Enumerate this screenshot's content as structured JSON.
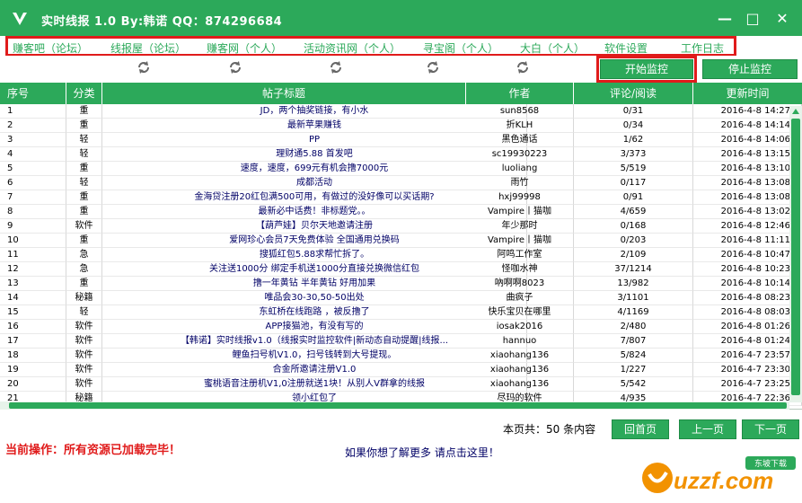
{
  "app": {
    "title": "实时线报 1.0  By:韩诺 QQ：874296684",
    "accent": "#2ca95a"
  },
  "window_controls": {
    "minimize": "—",
    "maximize": "□",
    "close": "✕"
  },
  "menu": {
    "items": [
      "赚客吧（论坛）",
      "线报屋（论坛）",
      "赚客网（个人）",
      "活动资讯网（个人）",
      "寻宝阁（个人）",
      "大白（个人）",
      "软件设置",
      "工作日志"
    ]
  },
  "toolbar": {
    "start_label": "开始监控",
    "stop_label": "停止监控",
    "refresh_icons": [
      "refresh-icon",
      "refresh-icon",
      "refresh-icon",
      "refresh-icon",
      "refresh-icon"
    ]
  },
  "table": {
    "headers": [
      "序号",
      "分类",
      "帖子标题",
      "作者",
      "评论/阅读",
      "更新时间"
    ],
    "rows": [
      [
        "1",
        "重",
        "JD，两个抽奖链接，有小水",
        "sun8568",
        "0/31",
        "2016-4-8 14:27"
      ],
      [
        "2",
        "重",
        "最新苹果赚钱",
        "折KLH",
        "0/34",
        "2016-4-8 14:14"
      ],
      [
        "3",
        "轻",
        "PP",
        "黑色通话",
        "1/62",
        "2016-4-8 14:06"
      ],
      [
        "4",
        "轻",
        "理财通5.88 首发吧",
        "sc19930223",
        "3/373",
        "2016-4-8 13:15"
      ],
      [
        "5",
        "重",
        "速度，速度，699元有机会撸7000元",
        "luoliang",
        "5/519",
        "2016-4-8 13:10"
      ],
      [
        "6",
        "轻",
        "成都活动",
        "雨竹",
        "0/117",
        "2016-4-8 13:08"
      ],
      [
        "7",
        "重",
        "金海贷注册20红包满500可用，有做过的没好像可以买话期?",
        "hxj99998",
        "0/91",
        "2016-4-8 13:08"
      ],
      [
        "8",
        "重",
        "最新必中话费！非标题党。。",
        "Vampire丨猫咖",
        "4/659",
        "2016-4-8 13:02"
      ],
      [
        "9",
        "软件",
        "【葫芦娃】贝尔天地邀请注册",
        "年少那时",
        "0/168",
        "2016-4-8 12:46"
      ],
      [
        "10",
        "重",
        "爱网珍心会员7天免费体验 全国通用兑换码",
        "Vampire丨猫咖",
        "0/203",
        "2016-4-8 11:11"
      ],
      [
        "11",
        "急",
        "搜狐红包5.88求帮忙拆了。",
        "阿鸣工作室",
        "2/109",
        "2016-4-8 10:47"
      ],
      [
        "12",
        "急",
        "关注送1000分 绑定手机送1000分直接兑换微信红包",
        "怪咖水神",
        "37/1214",
        "2016-4-8 10:23"
      ],
      [
        "13",
        "重",
        "撸一年黄钻    半年黄钻    好用加果",
        "吶啊啊8023",
        "13/982",
        "2016-4-8 10:14"
      ],
      [
        "14",
        "秘籍",
        "唯品会30-30,50-50出处",
        "曲疯子",
        "3/1101",
        "2016-4-8 08:23"
      ],
      [
        "15",
        "轻",
        "东虹桥在线跑路 ，被反撸了",
        "快乐宝贝在哪里",
        "4/1169",
        "2016-4-8 08:03"
      ],
      [
        "16",
        "软件",
        "APP接猫池，有没有写的",
        "iosak2016",
        "2/480",
        "2016-4-8 01:26"
      ],
      [
        "17",
        "软件",
        "【韩诺】实时线报v1.0（线报实时监控软件|新动态自动提醒|线报...",
        "hannuo",
        "7/807",
        "2016-4-8 01:24"
      ],
      [
        "18",
        "软件",
        "鲤鱼扫号机V1.0，扫号钱转到大号提现。",
        "xiaohang136",
        "5/824",
        "2016-4-7 23:57"
      ],
      [
        "19",
        "软件",
        "合金所邀请注册V1.0",
        "xiaohang136",
        "1/227",
        "2016-4-7 23:30"
      ],
      [
        "20",
        "软件",
        "蜜桃语音注册机V1,0注册就送1块！从别人V群拿的线报",
        "xiaohang136",
        "5/542",
        "2016-4-7 23:25"
      ],
      [
        "21",
        "秘籍",
        "领小红包了",
        "尽玛的软件",
        "4/935",
        "2016-4-7 22:36"
      ]
    ]
  },
  "footer": {
    "page_info": "本页共：50 条内容",
    "btn_home": "回首页",
    "btn_prev": "上一页",
    "btn_next": "下一页",
    "status": "当前操作：所有资源已加载完毕！",
    "learn_more": "如果你想了解更多 请点击这里！",
    "watermark_text": "uzzf.com",
    "watermark_badge": "东坡下载"
  }
}
